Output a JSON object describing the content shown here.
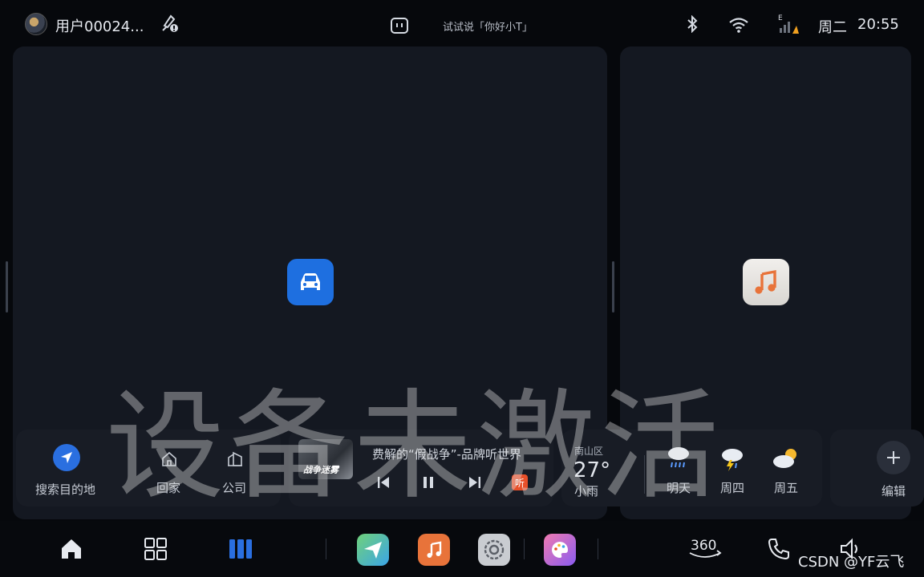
{
  "status_bar": {
    "username": "用户00024...",
    "voice_hint": "试试说「你好小T」",
    "weekday": "周二",
    "time": "20:55",
    "signal_label": "E"
  },
  "overlay": {
    "text": "设备未激活"
  },
  "navigation_widget": {
    "search_label": "搜索目的地",
    "home_label": "回家",
    "company_label": "公司"
  },
  "media_widget": {
    "album_text": "战争迷雾",
    "track_title": "费解的“假战争”-品牌听世界",
    "source_badge": "听"
  },
  "weather_widget": {
    "district": "南山区",
    "temperature": "27°",
    "condition": "小雨",
    "forecast": [
      {
        "day": "明天",
        "icon": "heavy-rain-icon"
      },
      {
        "day": "周四",
        "icon": "thunderstorm-icon"
      },
      {
        "day": "周五",
        "icon": "partly-cloudy-icon"
      }
    ]
  },
  "edit_widget": {
    "label": "编辑"
  },
  "dock": {
    "items": [
      "home-icon",
      "apps-grid-icon",
      "split-view-icon",
      "navigation-app-icon",
      "music-app-icon",
      "settings-app-icon",
      "theme-app-icon",
      "camera-360-icon",
      "phone-icon",
      "volume-icon"
    ],
    "camera_label": "360"
  },
  "watermark": "CSDN @YF云飞",
  "colors": {
    "accent_blue": "#2a6fe0",
    "card_bg": "#141821",
    "music_orange": "#e8733a"
  }
}
